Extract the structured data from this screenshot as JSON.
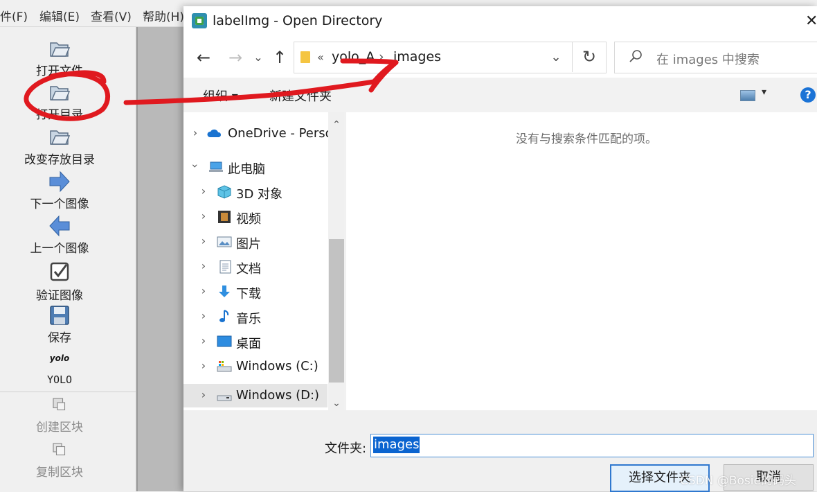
{
  "menubar": {
    "items": [
      "件(F)",
      "编辑(E)",
      "查看(V)",
      "帮助(H)"
    ]
  },
  "toolbar": {
    "items": [
      {
        "label": "打开文件",
        "icon": "folder-open-icon"
      },
      {
        "label": "打开目录",
        "icon": "folder-open-icon"
      },
      {
        "label": "改变存放目录",
        "icon": "folder-open-icon"
      },
      {
        "label": "下一个图像",
        "icon": "arrow-right-icon"
      },
      {
        "label": "上一个图像",
        "icon": "arrow-left-icon"
      },
      {
        "label": "验证图像",
        "icon": "checkbox-icon"
      },
      {
        "label": "保存",
        "icon": "floppy-disk-icon"
      },
      {
        "label": "YOLO",
        "icon": "yolo-text-icon",
        "icon_text": "yolo"
      },
      {
        "label": "创建区块",
        "icon": "create-box-icon"
      },
      {
        "label": "复制区块",
        "icon": "copy-box-icon"
      }
    ]
  },
  "dialog": {
    "title": "labelImg - Open Directory",
    "close_glyph": "✕",
    "nav": {
      "back": "←",
      "forward": "→",
      "recent": "⌄",
      "up": "↑",
      "refresh": "↻"
    },
    "address": {
      "overflow": "«",
      "crumbs": [
        "yolo_A",
        "images"
      ],
      "separator": "›",
      "dropdown": "⌄"
    },
    "search": {
      "icon_glyph": "⚲",
      "placeholder": "在 images 中搜索"
    },
    "commands": {
      "organize": "组织 ▾",
      "new_folder": "新建文件夹",
      "help": "?"
    },
    "tree": [
      {
        "label": "OneDrive - Perso",
        "icon": "onedrive-icon",
        "expanded": false,
        "level": 0
      },
      {
        "label": "此电脑",
        "icon": "this-pc-icon",
        "expanded": true,
        "level": 0
      },
      {
        "label": "3D 对象",
        "icon": "3d-objects-icon",
        "expanded": false,
        "level": 1
      },
      {
        "label": "视频",
        "icon": "videos-icon",
        "expanded": false,
        "level": 1
      },
      {
        "label": "图片",
        "icon": "pictures-icon",
        "expanded": false,
        "level": 1
      },
      {
        "label": "文档",
        "icon": "documents-icon",
        "expanded": false,
        "level": 1
      },
      {
        "label": "下载",
        "icon": "downloads-icon",
        "expanded": false,
        "level": 1
      },
      {
        "label": "音乐",
        "icon": "music-icon",
        "expanded": false,
        "level": 1
      },
      {
        "label": "桌面",
        "icon": "desktop-icon",
        "expanded": false,
        "level": 1
      },
      {
        "label": "Windows (C:)",
        "icon": "drive-c-icon",
        "expanded": false,
        "level": 1
      },
      {
        "label": "Windows (D:)",
        "icon": "drive-d-icon",
        "expanded": false,
        "level": 1,
        "selected": true
      }
    ],
    "empty_message": "没有与搜索条件匹配的项。",
    "folder_label": "文件夹:",
    "folder_value": "images",
    "buttons": {
      "select_folder": "选择文件夹",
      "cancel": "取消"
    }
  },
  "watermark": "CSDN @Bosie的码头",
  "colors": {
    "annotation_red": "#e0191f",
    "selection_blue": "#0a64d0",
    "primary_button_border": "#2f78cf"
  }
}
